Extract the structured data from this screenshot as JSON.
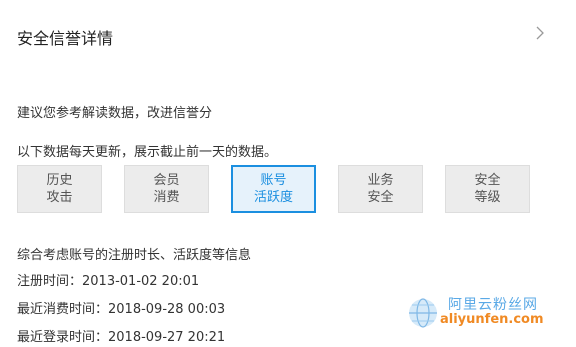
{
  "header": {
    "title": "安全信誉详情",
    "close_icon": "chevron-right-icon"
  },
  "tip": "建议您参考解读数据，改进信誉分",
  "update_note": "以下数据每天更新，展示截止前一天的数据。",
  "tabs": [
    {
      "line1": "历史",
      "line2": "攻击",
      "active": false
    },
    {
      "line1": "会员",
      "line2": "消费",
      "active": false
    },
    {
      "line1": "账号",
      "line2": "活跃度",
      "active": true
    },
    {
      "line1": "业务",
      "line2": "安全",
      "active": false
    },
    {
      "line1": "安全",
      "line2": "等级",
      "active": false
    }
  ],
  "detail": {
    "description": "综合考虑账号的注册时长、活跃度等信息",
    "register_time": "注册时间：2013-01-02 20:01",
    "last_consume_time": "最近消费时间：2018-09-28 00:03",
    "last_login_time": "最近登录时间：2018-09-27 20:21"
  },
  "watermark": {
    "cn": "阿里云粉丝网",
    "en": "aliyunfen.com"
  },
  "colors": {
    "accent": "#1b8fe0",
    "tab_bg": "#ececec",
    "tab_active_bg": "#e6f2fb",
    "watermark_orange": "#f08a24",
    "watermark_blue": "#5aa9e6"
  }
}
